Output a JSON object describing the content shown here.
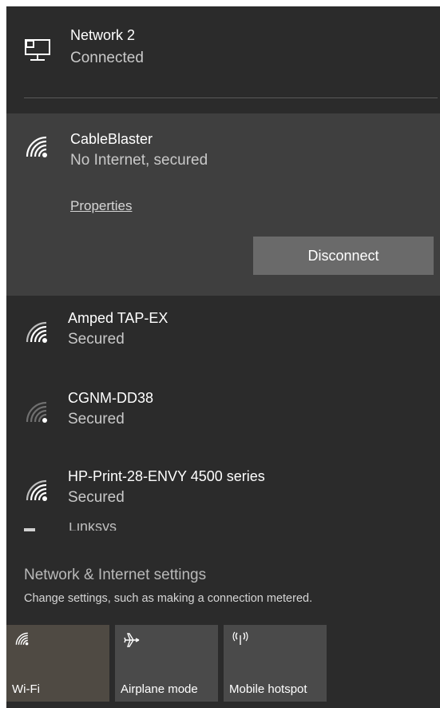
{
  "wired_network": {
    "name": "Network  2",
    "status": "Connected",
    "icon": "ethernet-icon"
  },
  "connected_wifi": {
    "name": "CableBlaster",
    "status": "No Internet, secured",
    "properties_label": "Properties",
    "disconnect_label": "Disconnect",
    "icon": "wifi-signal-icon"
  },
  "networks": [
    {
      "name": "Amped TAP-EX",
      "status": "Secured",
      "icon": "wifi-signal-icon"
    },
    {
      "name": "CGNM-DD38",
      "status": "Secured",
      "icon": "wifi-signal-weak-icon"
    },
    {
      "name": "HP-Print-28-ENVY 4500 series",
      "status": "Secured",
      "icon": "wifi-signal-icon"
    }
  ],
  "partial_network": {
    "name": "Linksys"
  },
  "settings": {
    "title": "Network & Internet settings",
    "subtitle": "Change settings, such as making a connection metered."
  },
  "quick_actions": [
    {
      "label": "Wi-Fi",
      "icon": "wifi-icon",
      "active": true
    },
    {
      "label": "Airplane mode",
      "icon": "airplane-icon",
      "active": false
    },
    {
      "label": "Mobile hotspot",
      "icon": "hotspot-icon",
      "active": false
    }
  ],
  "colors": {
    "panel_bg": "#2b2b2b",
    "expanded_bg": "#3f3f3f",
    "button_bg": "#6a6a6a",
    "tile_bg": "#4a4a4a"
  }
}
